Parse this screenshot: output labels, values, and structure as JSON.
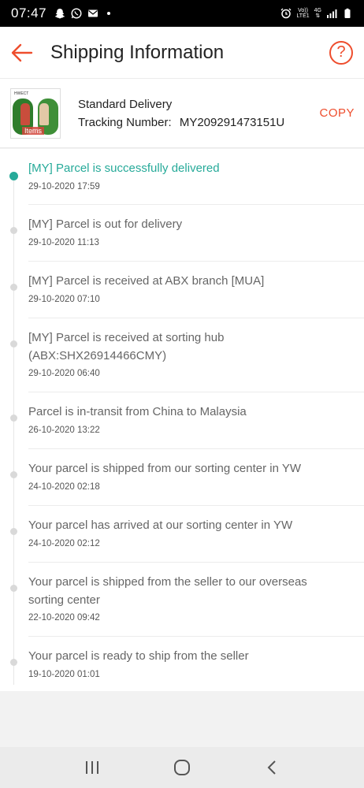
{
  "status_bar": {
    "time": "07:47",
    "volte": "Vo))",
    "lte": "LTE1",
    "network": "4G"
  },
  "header": {
    "title": "Shipping Information",
    "help_label": "?"
  },
  "delivery": {
    "method": "Standard Delivery",
    "tracking_label": "Tracking Number:",
    "tracking_number": "MY209291473151U",
    "copy_label": "COPY",
    "thumb_brand": "HWECT",
    "thumb_tag": "Items"
  },
  "timeline": [
    {
      "text": "[MY] Parcel is successfully delivered",
      "time": "29-10-2020 17:59",
      "active": true
    },
    {
      "text": "[MY] Parcel is out for delivery",
      "time": "29-10-2020 11:13",
      "active": false
    },
    {
      "text": "[MY] Parcel is received at ABX branch [MUA]",
      "time": "29-10-2020 07:10",
      "active": false
    },
    {
      "text": "[MY] Parcel is received at sorting hub (ABX:SHX26914466CMY)",
      "time": "29-10-2020 06:40",
      "active": false
    },
    {
      "text": "Parcel is in-transit from China to Malaysia",
      "time": "26-10-2020 13:22",
      "active": false
    },
    {
      "text": "Your parcel is shipped from our sorting center in YW",
      "time": "24-10-2020 02:18",
      "active": false
    },
    {
      "text": "Your parcel has arrived at our sorting center in YW",
      "time": "24-10-2020 02:12",
      "active": false
    },
    {
      "text": "Your parcel is shipped from the seller to our overseas sorting center",
      "time": "22-10-2020 09:42",
      "active": false
    },
    {
      "text": "Your parcel is ready to ship from the seller",
      "time": "19-10-2020 01:01",
      "active": false
    }
  ],
  "colors": {
    "accent": "#ee4d2d",
    "active_status": "#26aa99"
  },
  "icons": {
    "back": "arrow-left-icon",
    "help": "question-circle-icon",
    "recents": "recent-apps-icon",
    "home": "home-icon",
    "nav_back": "chevron-left-icon"
  }
}
